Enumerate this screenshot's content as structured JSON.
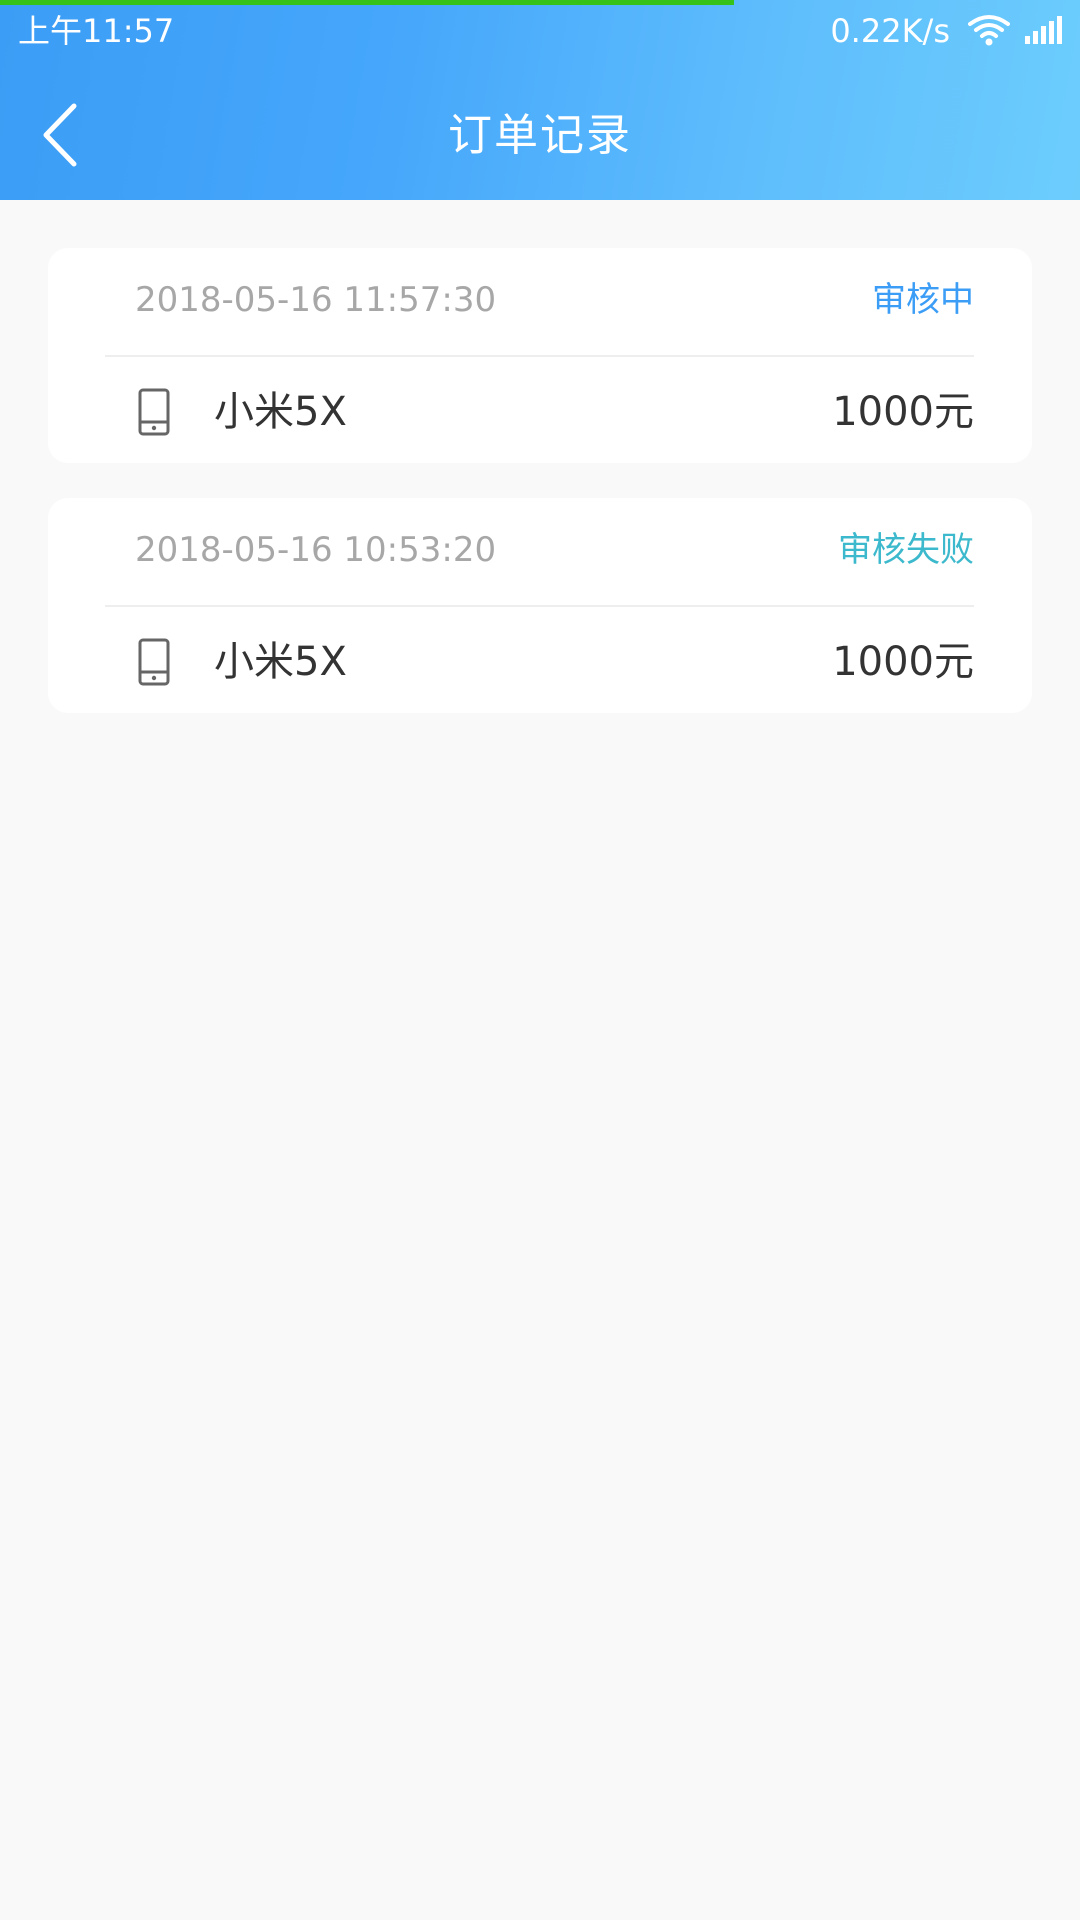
{
  "status_bar": {
    "time": "上午11:57",
    "network_speed": "0.22K/s",
    "wifi_icon": "wifi-icon",
    "signal_icon": "signal-icon"
  },
  "header": {
    "title": "订单记录",
    "back_icon": "chevron-left-icon"
  },
  "colors": {
    "header_gradient_start": "#3b9df5",
    "header_gradient_end": "#6ccdfd",
    "status_reviewing": "#3b9df5",
    "status_failed": "#3cb9cc",
    "page_background": "#f9f9f9",
    "progress_line": "#37c21a"
  },
  "orders": [
    {
      "datetime": "2018-05-16 11:57:30",
      "status": "审核中",
      "product_icon": "phone-icon",
      "product": "小米5X",
      "price": "1000元"
    },
    {
      "datetime": "2018-05-16 10:53:20",
      "status": "审核失败",
      "product_icon": "phone-icon",
      "product": "小米5X",
      "price": "1000元"
    }
  ]
}
